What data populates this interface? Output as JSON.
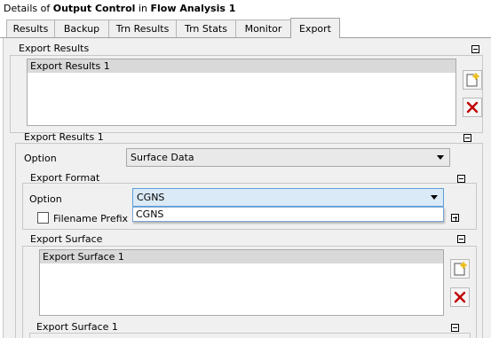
{
  "title": {
    "prefix": "Details of ",
    "object": "Output Control",
    "connector": " in ",
    "analysis": "Flow Analysis 1"
  },
  "tabs": [
    {
      "label": "Results"
    },
    {
      "label": "Backup"
    },
    {
      "label": "Trn Results"
    },
    {
      "label": "Trn Stats"
    },
    {
      "label": "Monitor"
    },
    {
      "label": "Export"
    }
  ],
  "active_tab": "Export",
  "export_results": {
    "header": "Export Results",
    "items": [
      "Export Results 1"
    ],
    "new_icon": "new-item-icon",
    "delete_icon": "delete-x-icon"
  },
  "export_results_1": {
    "header": "Export Results 1",
    "option_label": "Option",
    "option_value": "Surface Data"
  },
  "export_format": {
    "header": "Export Format",
    "option_label": "Option",
    "option_value": "CGNS",
    "dropdown_options": [
      "CGNS"
    ],
    "filename_prefix_label": "Filename Prefix",
    "filename_prefix_checked": false
  },
  "export_surface": {
    "header": "Export Surface",
    "items": [
      "Export Surface 1"
    ]
  },
  "export_surface_1": {
    "header": "Export Surface 1"
  },
  "colors": {
    "panel_bg": "#f0f0f0",
    "selected_item": "#d9d9d9",
    "combo_active": "#dbeaf7",
    "delete_red": "#c00000"
  }
}
